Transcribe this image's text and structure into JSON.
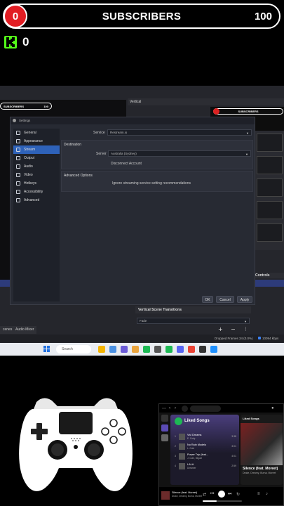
{
  "overlay": {
    "current_subscribers": "0",
    "title": "SUBSCRIBERS",
    "goal": "100",
    "kick_followers": "0",
    "colors": {
      "counter_red": "#e21d23",
      "kick_green": "#53fc18"
    }
  },
  "obs": {
    "preview_bar": {
      "title": "SUBSCRIBERS",
      "goal": "100"
    },
    "vertical_dock_title": "Vertical",
    "vertical_bar_title": "SUBSCRIBERS",
    "controls_title": "Controls",
    "vertical_scene_transitions": "Vertical Scene Transitions",
    "transition_value": "Fade",
    "bottom_tabs": [
      "cenes",
      "Audio Mixer"
    ],
    "status": {
      "dropped_frames": "Dropped Frames 34 (0.0%)",
      "bitrate": "10094 kbps"
    },
    "settings": {
      "title": "Settings",
      "sidebar": [
        {
          "label": "General",
          "icon": "gear-icon"
        },
        {
          "label": "Appearance",
          "icon": "appearance-icon"
        },
        {
          "label": "Stream",
          "icon": "stream-icon",
          "active": true
        },
        {
          "label": "Output",
          "icon": "output-icon"
        },
        {
          "label": "Audio",
          "icon": "audio-icon"
        },
        {
          "label": "Video",
          "icon": "video-icon"
        },
        {
          "label": "Hotkeys",
          "icon": "keyboard-icon"
        },
        {
          "label": "Accessibility",
          "icon": "accessibility-icon"
        },
        {
          "label": "Advanced",
          "icon": "wrench-icon"
        }
      ],
      "service_label": "Service",
      "service_value": "Restream.io",
      "destination_title": "Destination",
      "server_label": "Server",
      "server_value": "Australia (Sydney)",
      "disconnect_label": "Disconnect Account",
      "advanced_options_title": "Advanced Options",
      "ignore_label": "Ignore streaming service setting recommendations",
      "buttons": {
        "ok": "OK",
        "cancel": "Cancel",
        "apply": "Apply"
      }
    },
    "taskbar": {
      "search_placeholder": "Search"
    }
  },
  "spotify": {
    "playlist_title": "Liked Songs",
    "tracks": [
      {
        "num": "1",
        "name": "Vivi Dreams",
        "artist": "E. Cody",
        "duration": "3:38"
      },
      {
        "num": "2",
        "name": "No Rain Models",
        "artist": "L. Cole",
        "duration": "3:01"
      },
      {
        "num": "3",
        "name": "Power Trip (feat...",
        "artist": "J. Cole, Miguel",
        "duration": "4:01"
      },
      {
        "num": "4",
        "name": "LALA",
        "artist": "Dreamer",
        "duration": "2:59"
      }
    ],
    "right_panel_title": "Liked Songs",
    "now_title": "Silence (feat. Moreet)",
    "now_artist": "Drake, Dreamy, Burna, Moreet",
    "bottom_now_title": "Silence (feat. Moreet)",
    "bottom_now_artist": "Drake, Dreamy, Burna, Moreet",
    "progress": 0.35
  }
}
